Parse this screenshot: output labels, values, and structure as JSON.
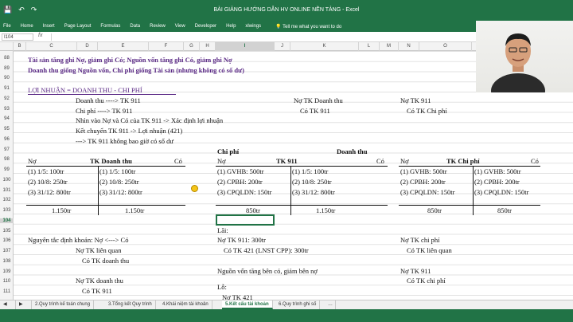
{
  "window": {
    "title": "BÀI GIẢNG HƯỚNG DẪN HV ONLINE NỀN TẢNG - Excel"
  },
  "ribbon": {
    "tabs": [
      "File",
      "Home",
      "Insert",
      "Page Layout",
      "Formulas",
      "Data",
      "Review",
      "View",
      "Developer",
      "Help",
      "xlwings"
    ],
    "tell_me": "Tell me what you want to do"
  },
  "formula_bar": {
    "name_box": "I104",
    "fx": "fx"
  },
  "columns": [
    "B",
    "C",
    "D",
    "E",
    "F",
    "G",
    "H",
    "I",
    "J",
    "K",
    "L",
    "M",
    "N",
    "O",
    "P",
    "Q"
  ],
  "selected_column": "I",
  "rows": [
    "88",
    "89",
    "90",
    "91",
    "92",
    "93",
    "94",
    "95",
    "96",
    "97",
    "98",
    "99",
    "100",
    "101",
    "102",
    "103",
    "104",
    "105",
    "106",
    "107",
    "108",
    "109",
    "110",
    "111",
    "112"
  ],
  "selected_row": "104",
  "sheet": {
    "r88": "Tài sản tăng ghi Nợ, giảm ghi Có; Nguồn vốn tăng ghi Có, giảm ghi Nợ",
    "r89": "Doanh thu giống Nguồn vốn, Chi phí giống Tài sản (nhưng không có số dư)",
    "r91": "LỢI NHUẬN = DOANH THU - CHI PHÍ",
    "r92a": "Doanh thu ----> TK 911",
    "r92b": "Nợ TK Doanh thu",
    "r92c": "Nợ TK 911",
    "r93a": "Chi phí ----> TK 911",
    "r93b": "Có TK 911",
    "r93c": "Có TK Chi phí",
    "r94": "Nhìn vào Nợ và Có của TK 911 -> Xác định lợi nhuận",
    "r95": "Kết chuyển TK 911 -> Lợi nhuận (421)",
    "r96": "---> TK 911 không bao giờ có số dư",
    "r97a": "Chi phí",
    "r97b": "Doanh thu",
    "t1_no": "Nợ",
    "t1_title": "TK Doanh thu",
    "t1_co": "Có",
    "t2_no": "Nợ",
    "t2_title": "TK 911",
    "t2_co": "Có",
    "t3_no": "Nợ",
    "t3_title": "TK Chi phí",
    "t3_co": "Có",
    "t1_l1": "(1) 1/5: 100tr",
    "t1_l2": "(2) 10/8: 250tr",
    "t1_l3": "(3) 31/12: 800tr",
    "t1_r1": "(1) 1/5: 100tr",
    "t1_r2": "(2) 10/8: 250tr",
    "t1_r3": "(3) 31/12: 800tr",
    "t2_l1": "(1) GVHB: 500tr",
    "t2_l2": "(2) CPBH: 200tr",
    "t2_l3": "(3) CPQLDN: 150tr",
    "t2_r1": "(1) 1/5: 100tr",
    "t2_r2": "(2) 10/8: 250tr",
    "t2_r3": "(3) 31/12: 800tr",
    "t3_l1": "(1) GVHB: 500tr",
    "t3_l2": "(2) CPBH: 200tr",
    "t3_l3": "(3) CPQLDN: 150tr",
    "t3_r1": "(1) GVHB: 500tr",
    "t3_r2": "(2) CPBH: 200tr",
    "t3_r3": "(3) CPQLDN: 150tr",
    "t1_sum_l": "1.150tr",
    "t1_sum_r": "1.150tr",
    "t2_sum_l": "850tr",
    "t2_sum_r": "1.150tr",
    "t3_sum_l": "850tr",
    "t3_sum_r": "850tr",
    "r105": "Lãi:",
    "r106a": "Nguyên tắc định khoản: Nợ <---> Có",
    "r106b": "Nợ TK 911: 300tr",
    "r106c": "Nợ TK chi phí",
    "r107a": "Nợ TK liên quan",
    "r107b": "Có TK 421 (LNST CPP): 300tr",
    "r107c": "Có TK liên quan",
    "r108": "Có TK doanh thu",
    "r109": "Nguồn vốn tăng bên có, giảm bên nợ",
    "r110a": "Nợ TK doanh thu",
    "r110b": "Nợ TK 911",
    "r111": "Có TK chi phí",
    "r112a": "Có TK 911",
    "r112b": "Lỗ:",
    "r113": "Nợ TK 421"
  },
  "sheet_tabs": [
    "2.Quy trình kế toán chung",
    "3.Tổng kết Quy trình",
    "4.Khái niệm tài khoản",
    "5.Kết cấu tài khoản",
    "6.Quy trình ghi số"
  ],
  "active_tab": "5.Kết cấu tài khoản",
  "colors": {
    "excel_green": "#217346",
    "heading_purple": "#5b2a86"
  }
}
